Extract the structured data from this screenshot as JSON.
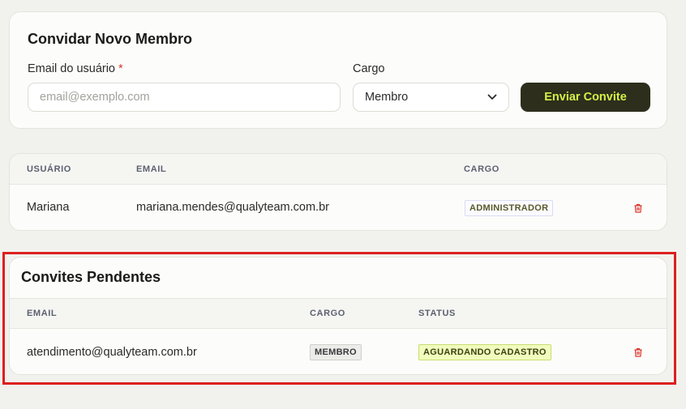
{
  "invite": {
    "title": "Convidar Novo Membro",
    "email_label": "Email do usuário",
    "required_mark": "*",
    "email_placeholder": "email@exemplo.com",
    "email_value": "",
    "cargo_label": "Cargo",
    "cargo_selected": "Membro",
    "send_label": "Enviar Convite"
  },
  "members": {
    "columns": [
      "USUÁRIO",
      "EMAIL",
      "CARGO"
    ],
    "rows": [
      {
        "user": "Mariana",
        "email": "mariana.mendes@qualyteam.com.br",
        "role": "ADMINISTRADOR"
      }
    ]
  },
  "pending": {
    "title": "Convites Pendentes",
    "columns": [
      "EMAIL",
      "CARGO",
      "STATUS"
    ],
    "rows": [
      {
        "email": "atendimento@qualyteam.com.br",
        "role": "MEMBRO",
        "status": "AGUARDANDO CADASTRO"
      }
    ]
  },
  "colors": {
    "accent_button_bg": "#2d2e1c",
    "accent_button_text": "#d6f046",
    "highlight_frame": "#dd1f1f",
    "danger_icon": "#d9342b"
  },
  "icons": {
    "delete": "trash-icon",
    "dropdown": "chevron-down-icon"
  }
}
